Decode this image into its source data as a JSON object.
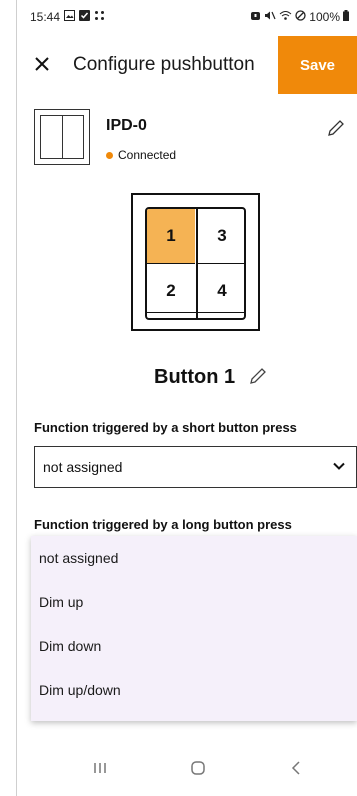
{
  "status_bar": {
    "time": "15:44",
    "left_icons": [
      "gallery-icon",
      "check-square-icon",
      "dots-grid-icon"
    ],
    "battery": "100%",
    "right_icons": [
      "alarm-icon",
      "mute-icon",
      "wifi-icon",
      "do-not-disturb-icon",
      "battery-icon"
    ]
  },
  "app_bar": {
    "title": "Configure pushbutton",
    "save_label": "Save",
    "accent_color": "#f0890a"
  },
  "device": {
    "name": "IPD-0",
    "status": "Connected"
  },
  "switch": {
    "buttons": [
      "1",
      "3",
      "2",
      "4"
    ],
    "selected": "1",
    "highlight_color": "#f5b354"
  },
  "button_title": "Button 1",
  "short_press": {
    "label": "Function triggered by a short button press",
    "value": "not assigned"
  },
  "long_press": {
    "label": "Function triggered by a long button press"
  },
  "dropdown_options": [
    "not assigned",
    "Dim up",
    "Dim down",
    "Dim up/down"
  ]
}
